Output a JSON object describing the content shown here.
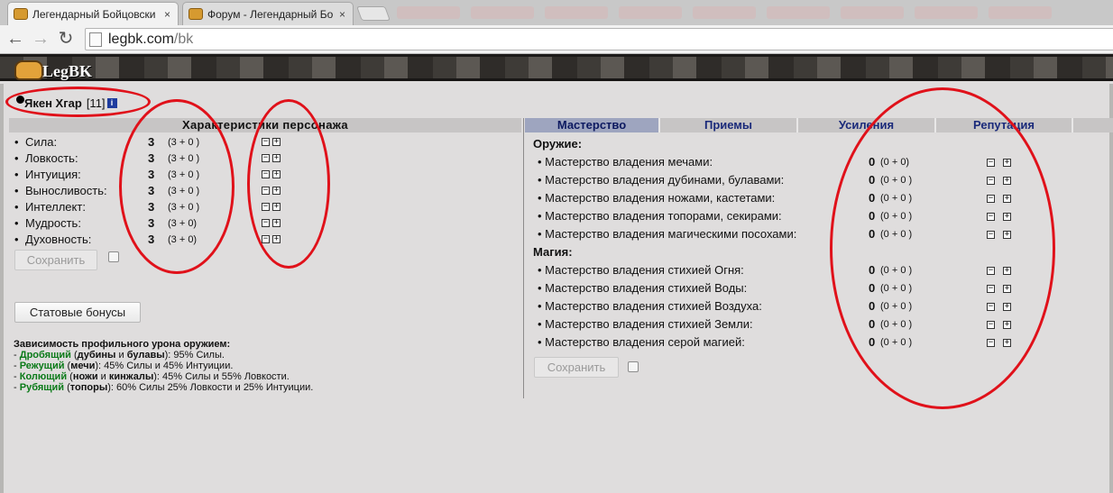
{
  "browser": {
    "tabs": [
      {
        "title": "Легендарный Бойцовски",
        "close": "×"
      },
      {
        "title": "Форум - Легендарный Бо",
        "close": "×"
      }
    ],
    "url_host": "legbk.com",
    "url_path": "/bk"
  },
  "site": {
    "logo": "LegBK"
  },
  "character": {
    "name": "Якен Хгар",
    "level": "[11]",
    "info": "i"
  },
  "stats": {
    "header": "Характеристики персонажа",
    "rows": [
      {
        "label": "Сила:",
        "value": "3",
        "detail": "(3 + 0 )"
      },
      {
        "label": "Ловкость:",
        "value": "3",
        "detail": "(3 + 0 )"
      },
      {
        "label": "Интуиция:",
        "value": "3",
        "detail": "(3 + 0 )"
      },
      {
        "label": "Выносливость:",
        "value": "3",
        "detail": "(3 + 0 )"
      },
      {
        "label": "Интеллект:",
        "value": "3",
        "detail": "(3 + 0 )"
      },
      {
        "label": "Мудрость:",
        "value": "3",
        "detail": "(3 + 0)"
      },
      {
        "label": "Духовность:",
        "value": "3",
        "detail": "(3 + 0)"
      }
    ],
    "save_label": "Сохранить",
    "bonuses_label": "Статовые бонусы"
  },
  "damage": {
    "title": "Зависимость профильного урона оружием:",
    "lines": [
      {
        "type": "Дробящий",
        "open": " (",
        "w1": "дубины",
        "mid": " и ",
        "w2": "булавы",
        "rest": "): 95% Силы."
      },
      {
        "type": "Режущий",
        "open": " (",
        "w1": "мечи",
        "mid": "",
        "w2": "",
        "rest": "): 45% Силы и 45% Интуиции."
      },
      {
        "type": "Колющий",
        "open": " (",
        "w1": "ножи",
        "mid": " и ",
        "w2": "кинжалы",
        "rest": "): 45% Силы и 55% Ловкости."
      },
      {
        "type": "Рубящий",
        "open": " (",
        "w1": "топоры",
        "mid": "",
        "w2": "",
        "rest": "): 60% Силы 25% Ловкости и 25% Интуиции."
      }
    ]
  },
  "mastery": {
    "tabs": [
      "Мастерство",
      "Приемы",
      "Усиления",
      "Репутация"
    ],
    "active_tab": "Мастерство",
    "weapons_title": "Оружие:",
    "weapons": [
      {
        "label": "• Мастерство владения мечами:",
        "value": "0",
        "detail": "(0 + 0)"
      },
      {
        "label": "• Мастерство владения дубинами, булавами:",
        "value": "0",
        "detail": "(0 + 0 )"
      },
      {
        "label": "• Мастерство владения ножами, кастетами:",
        "value": "0",
        "detail": "(0 + 0 )"
      },
      {
        "label": "• Мастерство владения топорами, секирами:",
        "value": "0",
        "detail": "(0 + 0 )"
      },
      {
        "label": "• Мастерство владения магическими посохами:",
        "value": "0",
        "detail": "(0 + 0 )"
      }
    ],
    "magic_title": "Магия:",
    "magic": [
      {
        "label": "• Мастерство владения стихией Огня:",
        "value": "0",
        "detail": "(0 + 0 )"
      },
      {
        "label": "• Мастерство владения стихией Воды:",
        "value": "0",
        "detail": "(0 + 0 )"
      },
      {
        "label": "• Мастерство владения стихией Воздуха:",
        "value": "0",
        "detail": "(0 + 0 )"
      },
      {
        "label": "• Мастерство владения стихией Земли:",
        "value": "0",
        "detail": "(0 + 0 )"
      },
      {
        "label": "• Мастерство владения серой магией:",
        "value": "0",
        "detail": "(0 + 0 )"
      }
    ],
    "save_label": "Сохранить"
  },
  "annotation_color": "#e0111a",
  "icons": {
    "minus": "−",
    "plus": "+"
  }
}
